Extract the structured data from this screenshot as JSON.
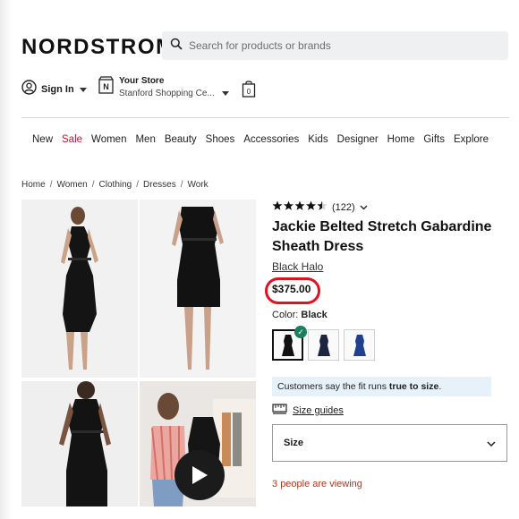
{
  "header": {
    "logo": "NORDSTROM",
    "search_placeholder": "Search for products or brands",
    "sign_in": "Sign In",
    "store_title": "Your Store",
    "store_name": "Stanford Shopping Ce...",
    "bag_count": "0"
  },
  "nav": [
    "New",
    "Sale",
    "Women",
    "Men",
    "Beauty",
    "Shoes",
    "Accessories",
    "Kids",
    "Designer",
    "Home",
    "Gifts",
    "Explore"
  ],
  "breadcrumb": [
    "Home",
    "Women",
    "Clothing",
    "Dresses",
    "Work"
  ],
  "product": {
    "rating_value": 4.5,
    "rating_count": "(122)",
    "title": "Jackie Belted Stretch Gabardine Sheath Dress",
    "brand": "Black Halo",
    "price": "$375.00",
    "color_label": "Color:",
    "color_value": "Black",
    "swatches": [
      {
        "name": "Black",
        "color": "#111111",
        "selected": true
      },
      {
        "name": "Navy",
        "color": "#1c2540",
        "selected": false
      },
      {
        "name": "Blue",
        "color": "#1f3f8f",
        "selected": false
      }
    ],
    "fit_note_prefix": "Customers say the fit runs",
    "fit_note_bold": "true to size",
    "fit_note_suffix": ".",
    "size_guides": "Size guides",
    "size_label": "Size",
    "viewing_count": "3",
    "viewing_text": "people are viewing"
  },
  "colors": {
    "sale_red": "#c8102e",
    "price_ring": "#e3101f",
    "check_green": "#1a7f5a",
    "fit_note_bg": "#e6f1f9",
    "viewing": "#b0361e"
  }
}
